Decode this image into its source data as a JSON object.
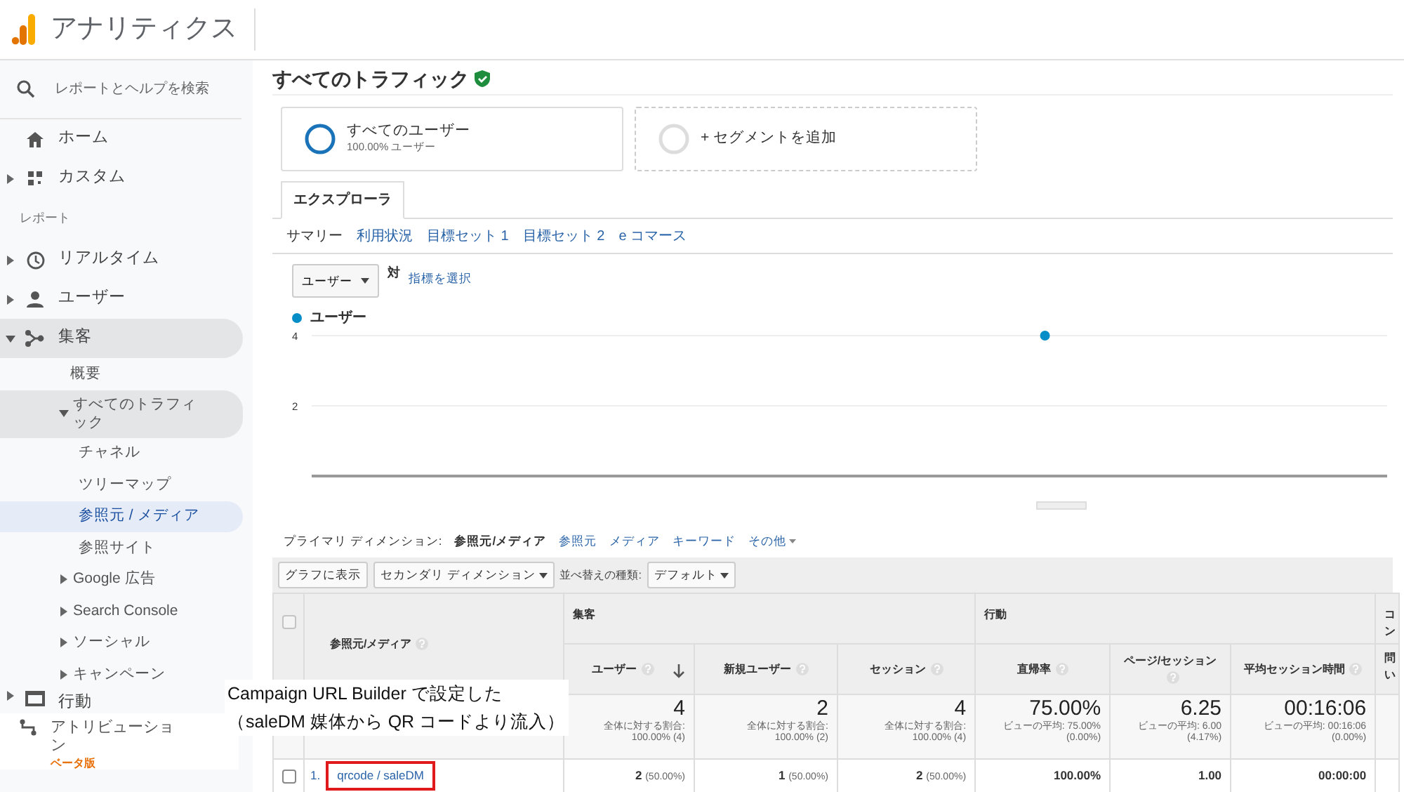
{
  "app": {
    "title": "アナリティクス"
  },
  "sidebar": {
    "search": {
      "placeholder": "レポートとヘルプを検索"
    },
    "items": [
      {
        "kind": "link",
        "label": "ホーム"
      },
      {
        "kind": "group",
        "label": "カスタム",
        "expanded": false
      },
      {
        "kind": "heading",
        "label": "レポート"
      },
      {
        "kind": "group",
        "label": "リアルタイム",
        "expanded": false
      },
      {
        "kind": "group",
        "label": "ユーザー",
        "expanded": false
      },
      {
        "kind": "group",
        "label": "集客",
        "expanded": true,
        "children": [
          {
            "label": "概要",
            "selected": false
          },
          {
            "label": "すべてのトラフィック",
            "expanded": true,
            "children": [
              {
                "label": "チャネル",
                "selected": false
              },
              {
                "label": "ツリーマップ",
                "selected": false
              },
              {
                "label": "参照元 / メディア",
                "selected": true
              },
              {
                "label": "参照サイト",
                "selected": false
              }
            ]
          },
          {
            "label": "Google 広告",
            "expanded": false
          },
          {
            "label": "Search Console",
            "expanded": false
          },
          {
            "label": "ソーシャル",
            "expanded": false
          },
          {
            "label": "キャンペーン",
            "expanded": false
          }
        ]
      },
      {
        "kind": "group",
        "label": "行動",
        "expanded": false
      }
    ],
    "attribution": {
      "label": "アトリビューション",
      "badge": "ベータ版"
    }
  },
  "page": {
    "title": "すべてのトラフィック",
    "verified": true
  },
  "segments": [
    {
      "kind": "segment",
      "name": "すべてのユーザー",
      "detail": "100.00% ユーザー"
    },
    {
      "kind": "add",
      "name": "+ セグメントを追加"
    }
  ],
  "tabs": [
    {
      "label": "エクスプローラ",
      "selected": true
    }
  ],
  "subtabs": [
    {
      "label": "サマリー",
      "selected": true
    },
    {
      "label": "利用状況",
      "selected": false
    },
    {
      "label": "目標セット 1",
      "selected": false
    },
    {
      "label": "目標セット 2",
      "selected": false
    },
    {
      "label": "e コマース",
      "selected": false
    }
  ],
  "metric_picker": {
    "value": "ユーザー",
    "versus": "対",
    "link": "指標を選択"
  },
  "chart": {
    "chart_data": {
      "type": "line",
      "series": [
        {
          "name": "ユーザー",
          "color": "#058dc7",
          "marker": "circle",
          "values": [
            null,
            null,
            null,
            null,
            null,
            null,
            null,
            4,
            null,
            null,
            null
          ]
        }
      ],
      "yticks": [
        2,
        4
      ],
      "ylim": [
        0,
        4
      ]
    }
  },
  "primary_dimension": {
    "label": "プライマリ ディメンション:",
    "options": [
      {
        "kind": "link",
        "label": "参照元/メディア",
        "selected": true
      },
      {
        "kind": "link",
        "label": "参照元",
        "selected": false
      },
      {
        "kind": "link",
        "label": "メディア",
        "selected": false
      },
      {
        "kind": "link",
        "label": "キーワード",
        "selected": false
      },
      {
        "kind": "menu",
        "label": "その他",
        "selected": false
      }
    ]
  },
  "toolbar": {
    "plot_button": "グラフに表示",
    "secondary_dimension": "セカンダリ ディメンション",
    "sort_label": "並べ替えの種類:",
    "sort_value": "デフォルト"
  },
  "table": {
    "dimension_header": "参照元/メディア",
    "select_all": {
      "checked": false,
      "disabled": true
    },
    "groups": [
      {
        "label": "集客"
      },
      {
        "label": "行動"
      },
      {
        "label": "コン"
      }
    ],
    "columns": [
      {
        "label": "ユーザー",
        "sorted": true,
        "help": true
      },
      {
        "label": "新規ユーザー",
        "sorted": false,
        "help": true
      },
      {
        "label": "セッション",
        "sorted": false,
        "help": true
      },
      {
        "label": "直帰率",
        "sorted": false,
        "help": true
      },
      {
        "label": "ページ/セッション",
        "sorted": false,
        "help": true
      },
      {
        "label": "平均セッション時間",
        "sorted": false,
        "help": true
      },
      {
        "label": "問い",
        "sorted": false,
        "help": false
      }
    ],
    "totals": [
      {
        "value": "4",
        "note": "全体に対する割合:",
        "detail": "100.00% (4)"
      },
      {
        "value": "2",
        "note": "全体に対する割合:",
        "detail": "100.00% (2)"
      },
      {
        "value": "4",
        "note": "全体に対する割合:",
        "detail": "100.00% (4)"
      },
      {
        "value": "75.00%",
        "note": "ビューの平均: 75.00%",
        "detail": "(0.00%)"
      },
      {
        "value": "6.25",
        "note": "ビューの平均: 6.00",
        "detail": "(4.17%)"
      },
      {
        "value": "00:16:06",
        "note": "ビューの平均: 00:16:06",
        "detail": "(0.00%)"
      }
    ],
    "rows": [
      {
        "index": "1.",
        "dimension": "qrcode / saleDM",
        "checked": false,
        "highlighted": true,
        "cells": [
          {
            "value": "2",
            "share": "(50.00%)"
          },
          {
            "value": "1",
            "share": "(50.00%)"
          },
          {
            "value": "2",
            "share": "(50.00%)"
          },
          {
            "value": "100.00%"
          },
          {
            "value": "1.00"
          },
          {
            "value": "00:00:00"
          }
        ]
      }
    ]
  },
  "annotation": {
    "lines": [
      "Campaign URL Builder で設定した",
      "（saleDM 媒体から QR コードより流入）"
    ]
  }
}
